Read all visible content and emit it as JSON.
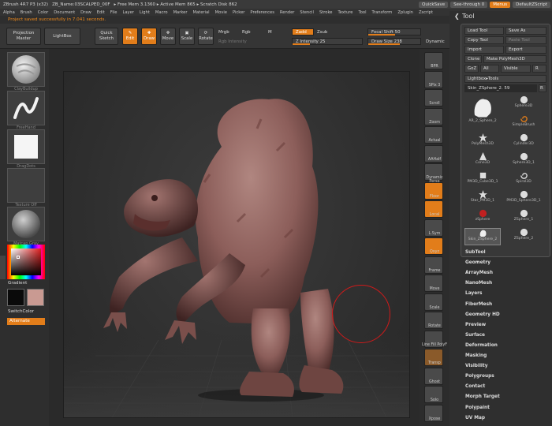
{
  "titlebar": {
    "items": [
      "ZBrush 4R7 P3 (x32)",
      "ZB_Name:03SCALPED_00F",
      "▸ Free Mem 3.1360 ▸ Active Mem 865 ▸ Scratch Disk 862"
    ],
    "quicksave": "QuickSave",
    "seethrough": "See-through 0",
    "menus": "Menus",
    "script": "DefaultZScript"
  },
  "menubar": [
    "Alpha",
    "Brush",
    "Color",
    "Document",
    "Draw",
    "Edit",
    "File",
    "Layer",
    "Light",
    "Macro",
    "Marker",
    "Material",
    "Movie",
    "Picker",
    "Preferences",
    "Render",
    "Stencil",
    "Stroke",
    "Texture",
    "Tool",
    "Transform",
    "Zplugin",
    "Zscript"
  ],
  "notice": "Project saved successfully in 7.041 seconds.",
  "toolbar": {
    "projection_master": "Projection Master",
    "lightbox": "LightBox",
    "quick_sketch": "Quick Sketch",
    "edit": "Edit",
    "draw": "Draw",
    "move": "Move",
    "scale": "Scale",
    "rotate": "Rotate",
    "mrgb": "Mrgb",
    "rgb": "Rgb",
    "m": "M",
    "rgb_intensity": "Rgb Intensity",
    "zadd": "Zadd",
    "zsub": "Zsub",
    "z_intensity": "Z Intensity 25",
    "z_intensity_value": 25,
    "focal_shift": "Focal Shift 50",
    "focal_shift_value": 50,
    "draw_size": "Draw Size 238",
    "draw_size_value": 238,
    "dynamic": "Dynamic"
  },
  "leftshelf": {
    "clay_buildup": "ClayBuildup",
    "freehand": "FreeHand",
    "dots": "DragDots",
    "texture_off": "Texture Off",
    "matcap": "Matcap Gray",
    "gradient": "Gradient",
    "switch_color": "SwitchColor",
    "alternate": "Alternate",
    "colors": {
      "primary": "#0a0a0a",
      "secondary": "#c99a92",
      "accent": "#e27d1a",
      "model": "#8c5e5a"
    }
  },
  "rightshelf": [
    "BPR",
    "SPix 3",
    "Scroll",
    "Zoom",
    "Actual",
    "AAHalf",
    "Dynamic Persp",
    "Floor",
    "Local",
    "L.Sym",
    "Qxyz",
    "Frame",
    "Move",
    "Scale",
    "Rotate",
    "Line Fill PolyF",
    "Transp",
    "Ghost",
    "Solo",
    "Xpose"
  ],
  "tray": {
    "title": "Tool",
    "load_tool": "Load Tool",
    "save_as": "Save As",
    "copy_tool": "Copy Tool",
    "paste_tool": "Paste Tool",
    "import": "Import",
    "export": "Export",
    "clone": "Clone",
    "make_polymesh": "Make PolyMesh3D",
    "goz": "GoZ",
    "all": "All",
    "visible": "Visible",
    "r": "R",
    "lightbox_tools": "Lightbox▸Tools",
    "current_tool": "Skin_ZSphere_2. 59",
    "tools": [
      "AR_2_Sphere_2",
      "Sphere3D",
      "SimpleBrush",
      "PolyMesh3D",
      "Cylinder3D",
      "Cone3D",
      "Sphere3D_1",
      "PM3D_Cube3D_1",
      "Spiral3D",
      "Star_PM3D_1",
      "PM3D_Sphere3D_1",
      "zSphere",
      "ZSphere_1",
      "Skin_ZSphere_2",
      "ZSphere_2"
    ],
    "subpalettes": [
      "SubTool",
      "Geometry",
      "ArrayMesh",
      "NanoMesh",
      "Layers",
      "FiberMesh",
      "Geometry HD",
      "Preview",
      "Surface",
      "Deformation",
      "Masking",
      "Visibility",
      "Polygroups",
      "Contact",
      "Morph Target",
      "Polypaint",
      "UV Map"
    ]
  }
}
